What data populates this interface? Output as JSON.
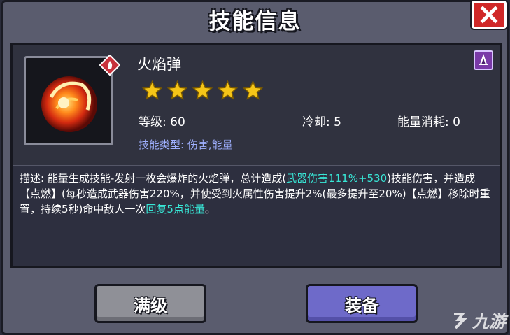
{
  "dialog": {
    "title": "技能信息",
    "close_icon": "close-icon"
  },
  "skill": {
    "name": "火焰弹",
    "stars": 5,
    "level_label": "等级: 60",
    "cooldown_label": "冷却: 5",
    "energy_label": "能量消耗: 0",
    "type_label": "技能类型: 伤害,能量",
    "icon": "fireball-icon",
    "element_badge": "fire-element-icon",
    "class_badge": "mage-class-icon"
  },
  "description": {
    "part1": "描述: 能量生成技能-发射一枚会爆炸的火焰弹，总计造成(",
    "hl1": "武器伤害111%+530",
    "part2": ")技能伤害，并造成【点燃】(每秒造成武器伤害220%，并使受到火属性伤害提升2%(最多提升至20%)【点燃】移除时重置，持续5秒)命中敌人一次",
    "hl2": "回复5点能量",
    "part3": "。"
  },
  "buttons": {
    "max_level": "满级",
    "equip": "装备"
  },
  "watermark": {
    "text": "九游"
  },
  "colors": {
    "highlight": "#38e6d6",
    "star": "#f5c518",
    "close_bg": "#d02828",
    "equip_bg": "#6e6ac9",
    "max_bg": "#8f9097"
  }
}
